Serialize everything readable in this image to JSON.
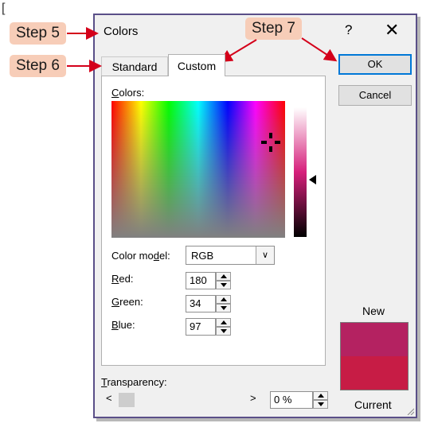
{
  "dialog": {
    "title": "Colors",
    "help_label": "?",
    "close_label": "✕",
    "tabs": [
      {
        "label": "Standard",
        "selected": false
      },
      {
        "label": "Custom",
        "selected": true
      }
    ],
    "ok_label": "OK",
    "cancel_label": "Cancel"
  },
  "custom": {
    "colors_label": "Colors:",
    "color_model_label": "Color model:",
    "color_model_value": "RGB",
    "red_label": "Red:",
    "red_value": "180",
    "green_label": "Green:",
    "green_value": "34",
    "blue_label": "Blue:",
    "blue_value": "97",
    "transparency_label": "Transparency:",
    "transparency_value": "0 %",
    "transparency_fraction": 0,
    "slider_left": "<",
    "slider_right": ">"
  },
  "preview": {
    "new_label": "New",
    "current_label": "Current",
    "new_color": "#b42261",
    "current_color": "#c71c45"
  },
  "annotations": {
    "step5": "Step 5",
    "step6": "Step 6",
    "step7": "Step 7",
    "bracket": "["
  },
  "colors": {
    "accent": "#0078d7",
    "annotation_fill": "#f7cdb8",
    "arrow": "#d4001a",
    "dialog_border": "#5a4f88"
  }
}
